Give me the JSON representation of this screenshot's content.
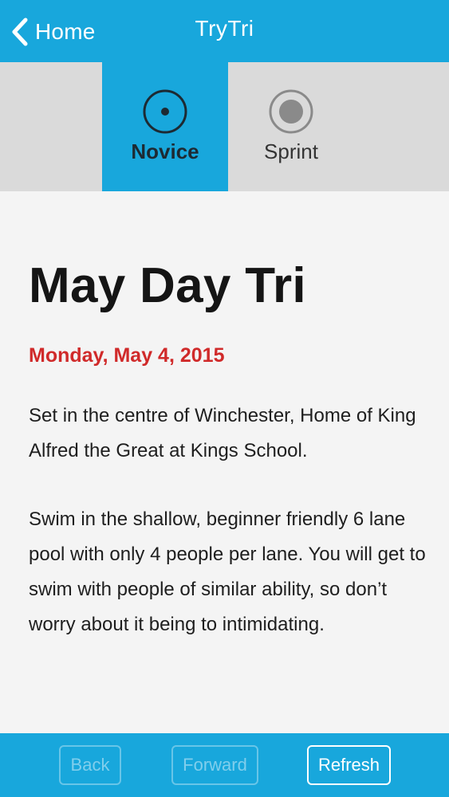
{
  "nav": {
    "back_label": "Home",
    "title": "TryTri"
  },
  "tabs": [
    {
      "label": "Novice",
      "selected": true
    },
    {
      "label": "Sprint",
      "selected": false
    }
  ],
  "event": {
    "title": "May Day Tri",
    "date": "Monday, May 4, 2015",
    "paragraphs": [
      "Set in the centre of Winchester, Home of King Alfred the Great at Kings School.",
      "Swim in the shallow, beginner friendly 6 lane pool with only 4 people per lane. You will get to swim with people of similar ability, so don’t worry about it being to intimidating."
    ]
  },
  "toolbar": {
    "back_label": "Back",
    "forward_label": "Forward",
    "refresh_label": "Refresh"
  },
  "colors": {
    "accent": "#18a7dc",
    "date": "#d02a2a",
    "tab_inactive": "#dadada",
    "background": "#f4f4f4"
  },
  "icons": {
    "back": "chevron-left-icon",
    "novice": "radio-dot-icon",
    "sprint": "radio-filled-icon"
  }
}
